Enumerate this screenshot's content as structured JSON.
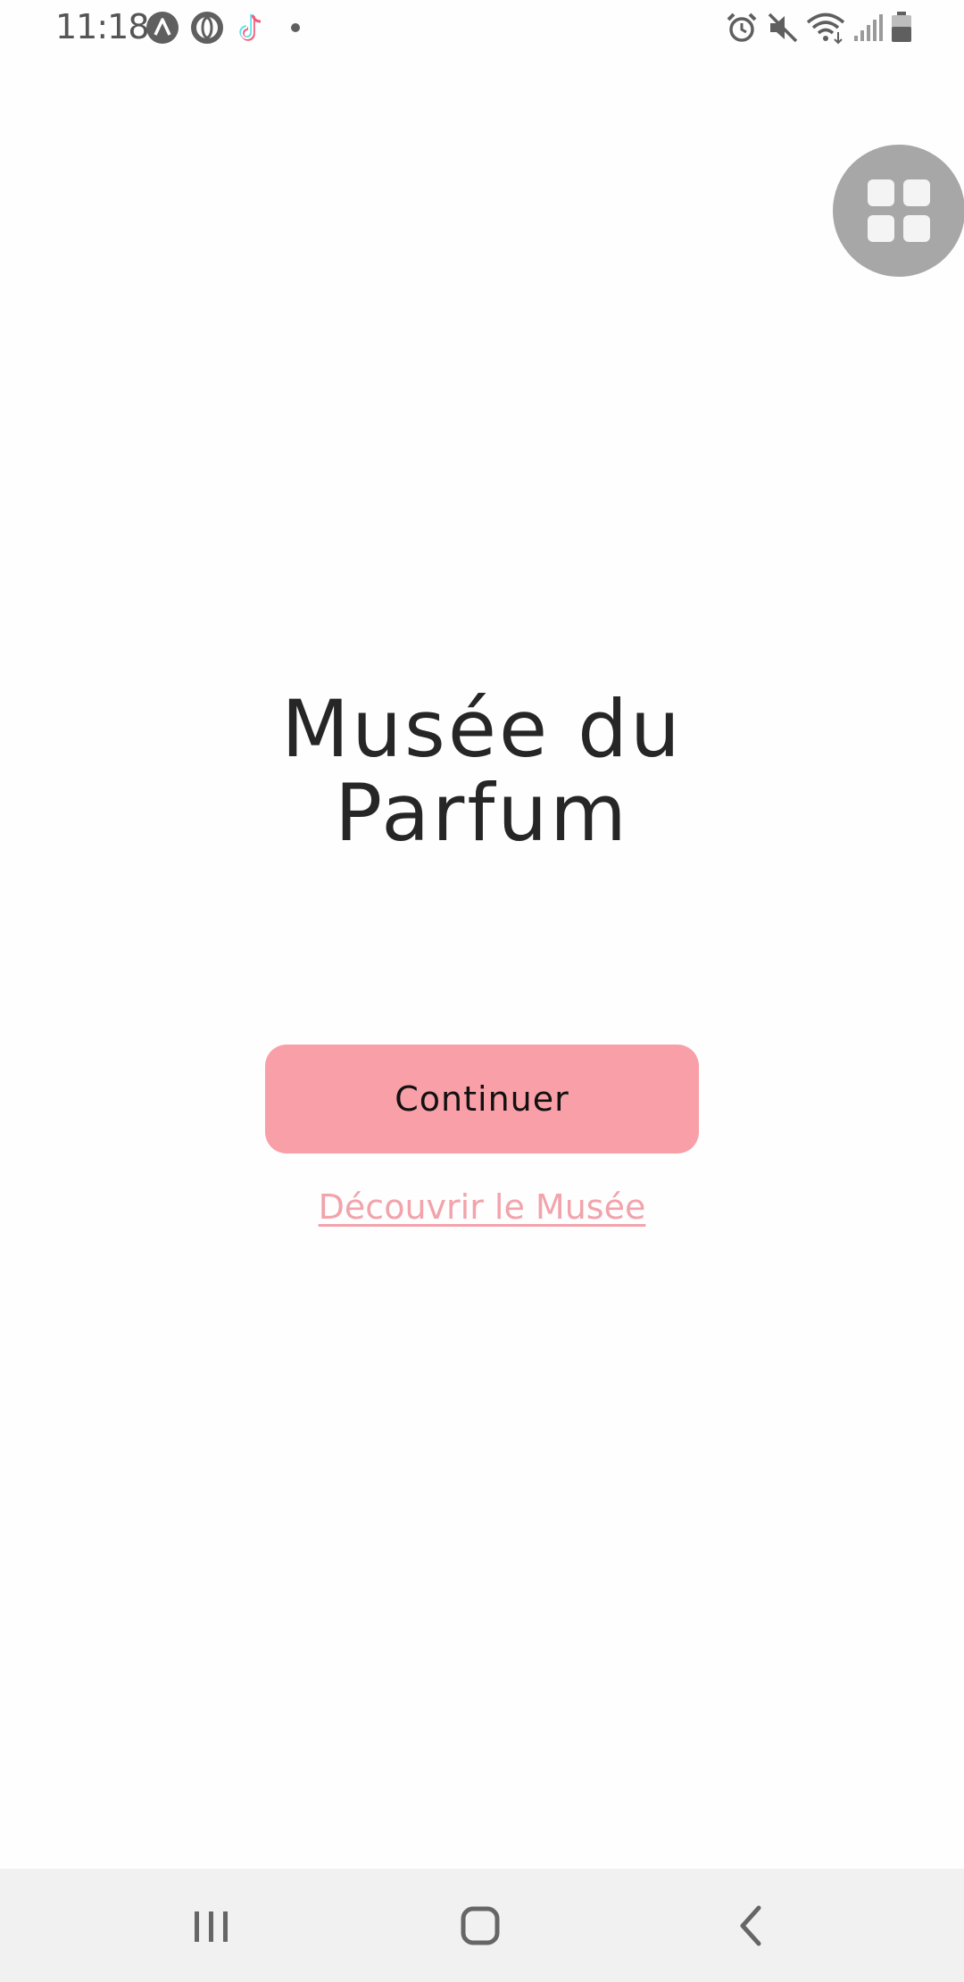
{
  "status_bar": {
    "time": "11:18",
    "left_icons": [
      "app-a-icon",
      "opera-icon",
      "tiktok-icon",
      "notification-dot-icon"
    ],
    "right_icons": [
      "alarm-icon",
      "mute-icon",
      "wifi-icon",
      "signal-icon",
      "battery-icon"
    ]
  },
  "floating_button": {
    "icon": "grid-icon"
  },
  "main": {
    "title_line1": "Musée du",
    "title_line2": "Parfum",
    "continue_label": "Continuer",
    "discover_label": "Découvrir le Musée"
  },
  "colors": {
    "button": "#f99fa7",
    "link": "#f2a3ab",
    "title": "#262626",
    "fab": "#a7a7a7",
    "nav_bar": "#f1f1f1"
  },
  "nav_bar": {
    "buttons": [
      "recents-icon",
      "home-icon",
      "back-icon"
    ]
  }
}
